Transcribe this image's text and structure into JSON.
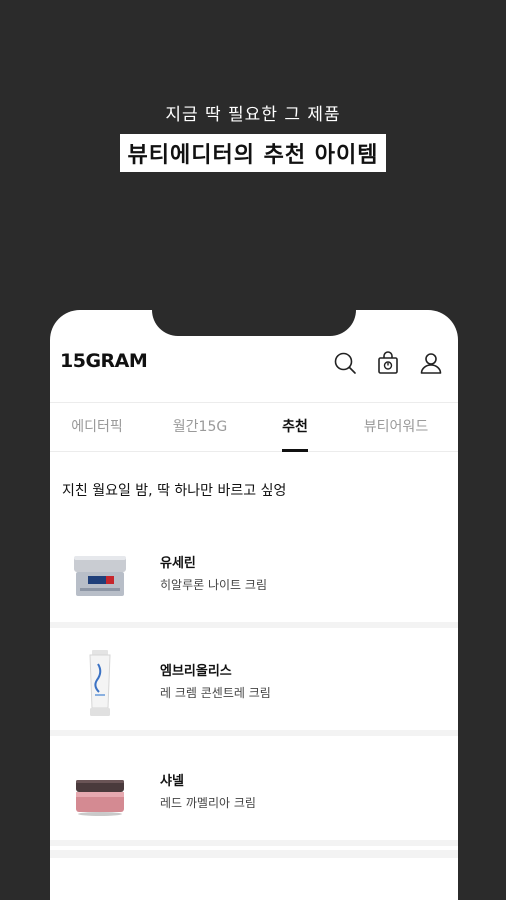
{
  "promo": {
    "subtitle": "지금 딱 필요한 그 제품",
    "title": "뷰티에디터의 추천 아이템"
  },
  "app": {
    "logo": "15GRAM",
    "icons": [
      "search-icon",
      "shopping-bag-icon",
      "user-icon"
    ]
  },
  "tabs": [
    {
      "label": "에디터픽",
      "active": false
    },
    {
      "label": "월간15G",
      "active": false
    },
    {
      "label": "추천",
      "active": true
    },
    {
      "label": "뷰티어워드",
      "active": false
    }
  ],
  "section": {
    "title": "지친 월요일 밤, 딱 하나만 바르고 싶엉"
  },
  "products": [
    {
      "brand": "유세린",
      "name": "히알루론 나이트 크림"
    },
    {
      "brand": "엠브리올리스",
      "name": "레 크렘 콘센트레 크림"
    },
    {
      "brand": "샤넬",
      "name": "레드 까멜리아 크림"
    }
  ]
}
